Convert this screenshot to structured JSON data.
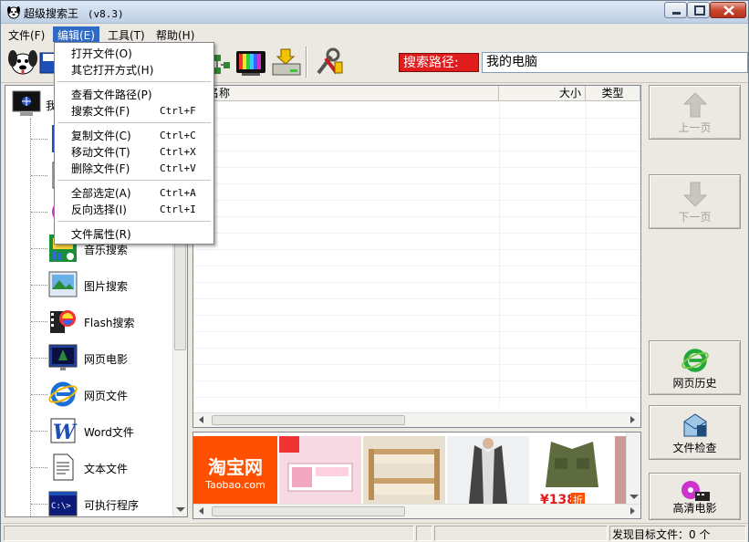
{
  "window": {
    "title": "超级搜索王",
    "version": "(v8.3)"
  },
  "menu": {
    "file": "文件(F)",
    "edit": "编辑(E)",
    "tools": "工具(T)",
    "help": "帮助(H)"
  },
  "edit_menu": {
    "open_file": "打开文件(O)",
    "open_with": "其它打开方式(H)",
    "view_path": "查看文件路径(P)",
    "search_file": "搜索文件(F)",
    "search_file_key": "Ctrl+F",
    "copy_file": "复制文件(C)",
    "copy_file_key": "Ctrl+C",
    "move_file": "移动文件(T)",
    "move_file_key": "Ctrl+X",
    "delete_file": "删除文件(F)",
    "delete_file_key": "Ctrl+V",
    "select_all": "全部选定(A)",
    "select_all_key": "Ctrl+A",
    "invert_select": "反向选择(I)",
    "invert_select_key": "Ctrl+I",
    "properties": "文件属性(R)"
  },
  "toolbar": {
    "path_label": "搜索路径:",
    "path_value": "我的电脑"
  },
  "tree": {
    "root": "我",
    "items": [
      {
        "label": "音乐搜索",
        "icon": "music-icon"
      },
      {
        "label": "图片搜索",
        "icon": "picture-icon"
      },
      {
        "label": "Flash搜索",
        "icon": "flash-icon"
      },
      {
        "label": "网页电影",
        "icon": "web-movie-icon"
      },
      {
        "label": "网页文件",
        "icon": "ie-icon"
      },
      {
        "label": "Word文件",
        "icon": "word-icon"
      },
      {
        "label": "文本文件",
        "icon": "text-file-icon"
      },
      {
        "label": "可执行程序",
        "icon": "exe-icon"
      }
    ]
  },
  "listview": {
    "col_name": "件名称",
    "col_size": "大小",
    "col_type": "类型"
  },
  "ad": {
    "taobao_cn": "淘宝网",
    "taobao_en": "Taobao.com",
    "price": "¥138",
    "discount": "折"
  },
  "right": {
    "prev_page": "上一页",
    "next_page": "下一页",
    "web_history": "网页历史",
    "file_check": "文件检查",
    "hd_movie": "高清电影"
  },
  "status": {
    "found_label": "发现目标文件：0 个"
  },
  "colors": {
    "menu_highlight": "#316ac5",
    "path_label_bg": "#e11c1c",
    "taobao_orange": "#ff5000"
  }
}
